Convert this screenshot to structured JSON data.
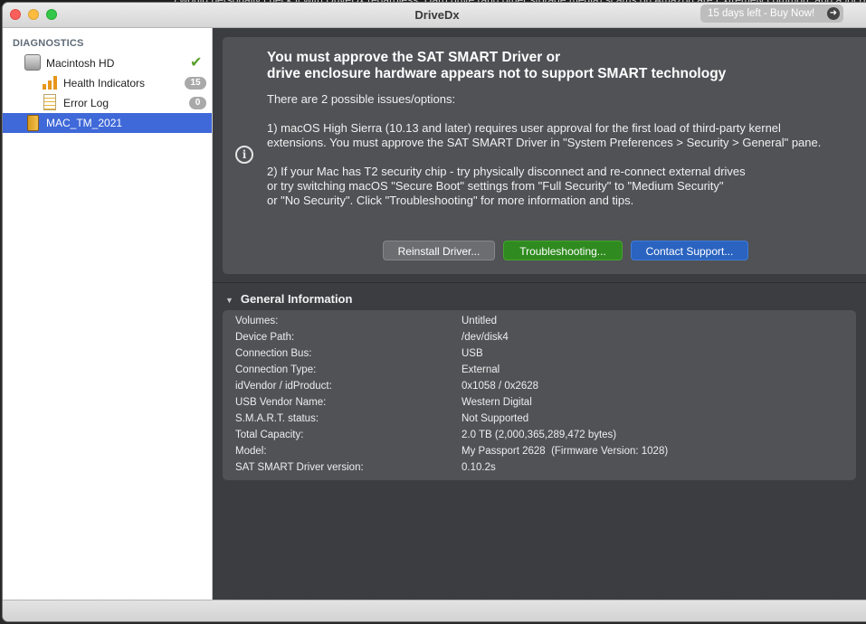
{
  "background_text": "I would personally check it with DriveDx regardless. Hard drive (and other storage media) scams on Amazon are Extremely common, and a lot of people have issues",
  "window": {
    "title": "DriveDx",
    "trial_label": "15 days left - Buy Now!",
    "trial_icon": "arrow-right-icon"
  },
  "sidebar": {
    "heading": "DIAGNOSTICS",
    "items": [
      {
        "label": "Macintosh HD",
        "icon": "hard-disk-icon",
        "status_icon": "checkmark-icon"
      },
      {
        "label": "Health Indicators",
        "icon": "bar-chart-icon",
        "badge": "15"
      },
      {
        "label": "Error Log",
        "icon": "log-icon",
        "badge": "0"
      },
      {
        "label": "MAC_TM_2021",
        "icon": "external-drive-icon",
        "selected": true
      }
    ]
  },
  "alert": {
    "icon": "info-icon",
    "title_line1": "You must approve the SAT SMART Driver or",
    "title_line2": "drive enclosure hardware appears not to support SMART technology",
    "intro": "There are 2 possible issues/options:",
    "issue1_line1": "1) macOS High Sierra (10.13 and later) requires user approval for the first load of third-party kernel",
    "issue1_line2": "extensions. You must approve the SAT SMART Driver in \"System Preferences > Security > General\" pane.",
    "issue2_line1": "2) If your Mac has T2 security chip - try physically disconnect and re-connect external drives",
    "issue2_line2": "or try switching macOS \"Secure Boot\" settings from \"Full Security\" to \"Medium Security\"",
    "issue2_line3": "or \"No Security\". Click \"Troubleshooting\" for more information and tips.",
    "buttons": {
      "reinstall": "Reinstall Driver...",
      "troubleshooting": "Troubleshooting...",
      "contact": "Contact Support..."
    }
  },
  "general_info": {
    "heading": "General Information",
    "rows": [
      {
        "key": "Volumes:",
        "value": "Untitled"
      },
      {
        "key": "Device Path:",
        "value": "/dev/disk4"
      },
      {
        "key": "Connection Bus:",
        "value": "USB"
      },
      {
        "key": "Connection Type:",
        "value": "External"
      },
      {
        "key": "idVendor / idProduct:",
        "value": "0x1058 / 0x2628"
      },
      {
        "key": "USB Vendor Name:",
        "value": "Western Digital"
      },
      {
        "key": "S.M.A.R.T. status:",
        "value": "Not Supported"
      },
      {
        "key": "Total Capacity:",
        "value": "2.0 TB (2,000,365,289,472 bytes)"
      },
      {
        "key": "Model:",
        "value": "My Passport 2628  (Firmware Version: 1028)"
      },
      {
        "key": "SAT SMART Driver version:",
        "value": "0.10.2s"
      }
    ]
  },
  "colors": {
    "selected": "#3f68d8",
    "panel": "#505256",
    "content_bg": "#3b3d40",
    "green_button": "#2f8a1f",
    "blue_button": "#2a63c0"
  }
}
